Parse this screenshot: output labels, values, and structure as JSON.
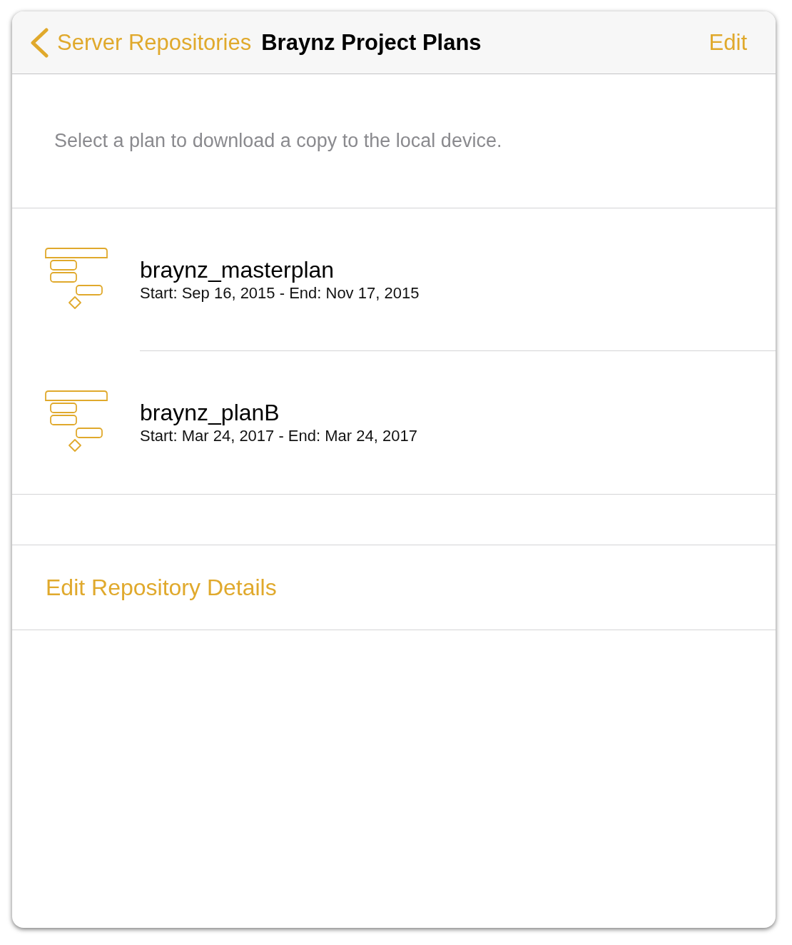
{
  "nav_bar": {
    "back_label": "Server Repositories",
    "title": "Braynz Project Plans",
    "edit_label": "Edit"
  },
  "description": "Select a plan to download a copy to the local device.",
  "plans": [
    {
      "name": "braynz_masterplan",
      "dates": "Start: Sep 16, 2015 - End: Nov 17, 2015"
    },
    {
      "name": "braynz_planB",
      "dates": "Start: Mar 24, 2017 - End: Mar 24, 2017"
    }
  ],
  "actions": [
    {
      "label": "Edit Repository Details"
    }
  ]
}
